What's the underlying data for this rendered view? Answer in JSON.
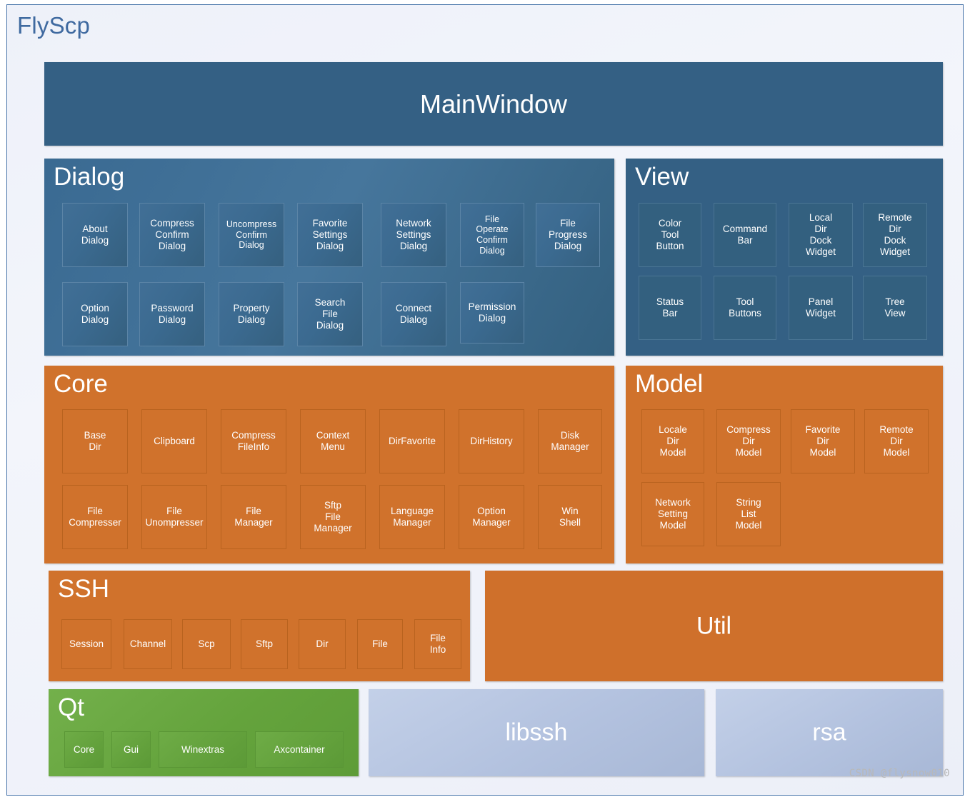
{
  "app": {
    "title": "FlyScp",
    "watermark": "CSDN @flysnow010"
  },
  "colors": {
    "title_blue": "#3f6aa0",
    "main_blue": "#346084",
    "panel_blue": "#346084",
    "orange": "#d0722c",
    "green": "#64a33c",
    "steel_blue": "#b3c2df",
    "background": "#eef1f9",
    "border": "#4472a8"
  },
  "mainwindow": {
    "label": "MainWindow"
  },
  "dialog": {
    "title": "Dialog",
    "items": [
      "About\nDialog",
      "Compress\nConfirm\nDialog",
      "Uncompress\nConfirm\nDialog",
      "Favorite\nSettings\nDialog",
      "Network\nSettings\nDialog",
      "File\nOperate\nConfirm\nDialog",
      "File\nProgress\nDialog",
      "Option\nDialog",
      "Password\nDialog",
      "Property\nDialog",
      "Search\nFile\nDialog",
      "Connect\nDialog",
      "Permission\nDialog"
    ]
  },
  "view": {
    "title": "View",
    "items": [
      "Color\nTool\nButton",
      "Command\nBar",
      "Local\nDir\nDock\nWidget",
      "Remote\nDir\nDock\nWidget",
      "Status\nBar",
      "Tool\nButtons",
      "Panel\nWidget",
      "Tree\nView"
    ]
  },
  "core": {
    "title": "Core",
    "items": [
      "Base\nDir",
      "Clipboard",
      "Compress\nFileInfo",
      "Context\nMenu",
      "DirFavorite",
      "DirHistory",
      "Disk\nManager",
      "File\nCompresser",
      "File\nUnompresser",
      "File\nManager",
      "Sftp\nFile\nManager",
      "Language\nManager",
      "Option\nManager",
      "Win\nShell"
    ]
  },
  "model": {
    "title": "Model",
    "items": [
      "Locale\nDir\nModel",
      "Compress\nDir\nModel",
      "Favorite\nDir\nModel",
      "Remote\nDir\nModel",
      "Network\nSetting\nModel",
      "String\nList\nModel"
    ]
  },
  "ssh": {
    "title": "SSH",
    "items": [
      "Session",
      "Channel",
      "Scp",
      "Sftp",
      "Dir",
      "File",
      "File\nInfo"
    ]
  },
  "util": {
    "label": "Util"
  },
  "qt": {
    "title": "Qt",
    "items": [
      "Core",
      "Gui",
      "Winextras",
      "Axcontainer"
    ]
  },
  "libssh": {
    "label": "libssh"
  },
  "rsa": {
    "label": "rsa"
  }
}
